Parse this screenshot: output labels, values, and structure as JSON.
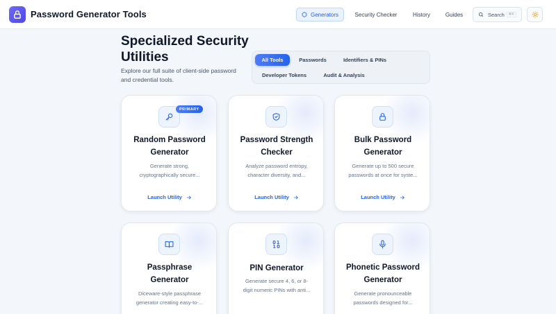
{
  "header": {
    "brand": "Password Generator Tools",
    "nav": [
      {
        "label": "Generators",
        "active": true
      },
      {
        "label": "Security Checker",
        "active": false
      },
      {
        "label": "History",
        "active": false
      },
      {
        "label": "Guides",
        "active": false
      }
    ],
    "search_label": "Search",
    "search_shortcut": "⌘K"
  },
  "hero": {
    "title": "Specialized Security Utilities",
    "subtitle": "Explore our full suite of client-side password and credential tools."
  },
  "filters": [
    {
      "label": "All Tools",
      "active": true
    },
    {
      "label": "Passwords",
      "active": false
    },
    {
      "label": "Identifiers & PINs",
      "active": false
    },
    {
      "label": "Developer Tokens",
      "active": false
    },
    {
      "label": "Audit & Analysis",
      "active": false
    }
  ],
  "cards": [
    {
      "icon": "key-icon",
      "badge": "PRIMARY",
      "title_line1": "Random Password",
      "title_line2": "Generator",
      "desc_line1": "Generate strong,",
      "desc_line2": "cryptographically secure...",
      "link": "Launch Utility"
    },
    {
      "icon": "shield-check-icon",
      "badge": "",
      "title_line1": "Password Strength",
      "title_line2": "Checker",
      "desc_line1": "Analyze password entropy,",
      "desc_line2": "character diversity, and...",
      "link": "Launch Utility"
    },
    {
      "icon": "lock-icon",
      "badge": "",
      "title_line1": "Bulk Password",
      "title_line2": "Generator",
      "desc_line1": "Generate up to 500 secure",
      "desc_line2": "passwords at once for syste...",
      "link": "Launch Utility"
    },
    {
      "icon": "book-open-icon",
      "badge": "",
      "title_line1": "Passphrase",
      "title_line2": "Generator",
      "desc_line1": "Diceware-style passphrase",
      "desc_line2": "generator creating easy-to-...",
      "link": ""
    },
    {
      "icon": "binary-icon",
      "badge": "",
      "title_line1": "PIN Generator",
      "title_line2": "",
      "desc_line1": "Generate secure 4, 6, or 8-",
      "desc_line2": "digit numeric PINs with anti...",
      "link": ""
    },
    {
      "icon": "microphone-icon",
      "badge": "",
      "title_line1": "Phonetic Password",
      "title_line2": "Generator",
      "desc_line1": "Generate pronounceable",
      "desc_line2": "passwords designed for...",
      "link": ""
    }
  ],
  "colors": {
    "accent": "#2563eb",
    "logo": "#5b57f0",
    "background": "#f3f6fa"
  }
}
